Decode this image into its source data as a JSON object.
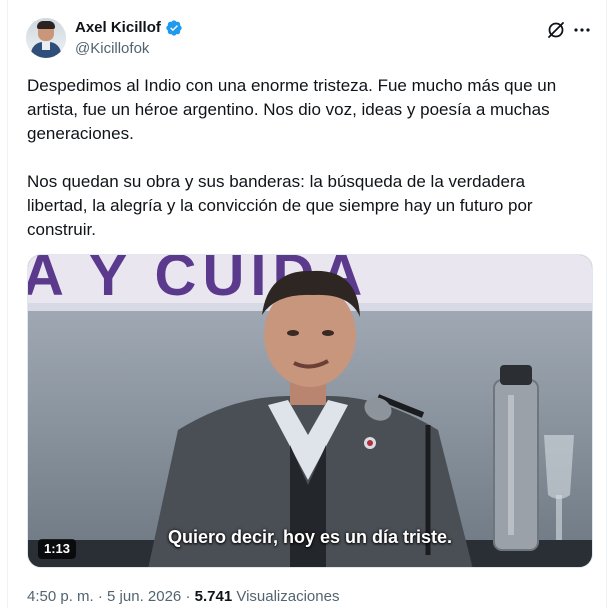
{
  "author": {
    "name": "Axel Kicillof",
    "handle": "@Kicillofok",
    "verified_color": "#1d9bf0"
  },
  "icons": {
    "avatar": "avatar-photo",
    "verified": "verified-badge-icon",
    "grok": "grok-icon",
    "more": "more-options-icon"
  },
  "tweet": {
    "paragraph_1": "Despedimos al Indio con una enorme tristeza. Fue mucho más que un artista, fue un héroe argentino. Nos dio voz, ideas y poesía a muchas generaciones.",
    "paragraph_2": "Nos quedan su obra y sus banderas: la búsqueda de la verdadera libertad, la alegría y la convicción de que siempre hay un futuro por construir."
  },
  "media": {
    "caption": "Quiero decir, hoy es un día triste.",
    "duration": "1:13",
    "banner_text": "A Y CUIDA"
  },
  "meta": {
    "time": "4:50 p. m.",
    "separator": "·",
    "date": "5 jun. 2026",
    "views_count": "5.741",
    "views_label": "Visualizaciones"
  }
}
